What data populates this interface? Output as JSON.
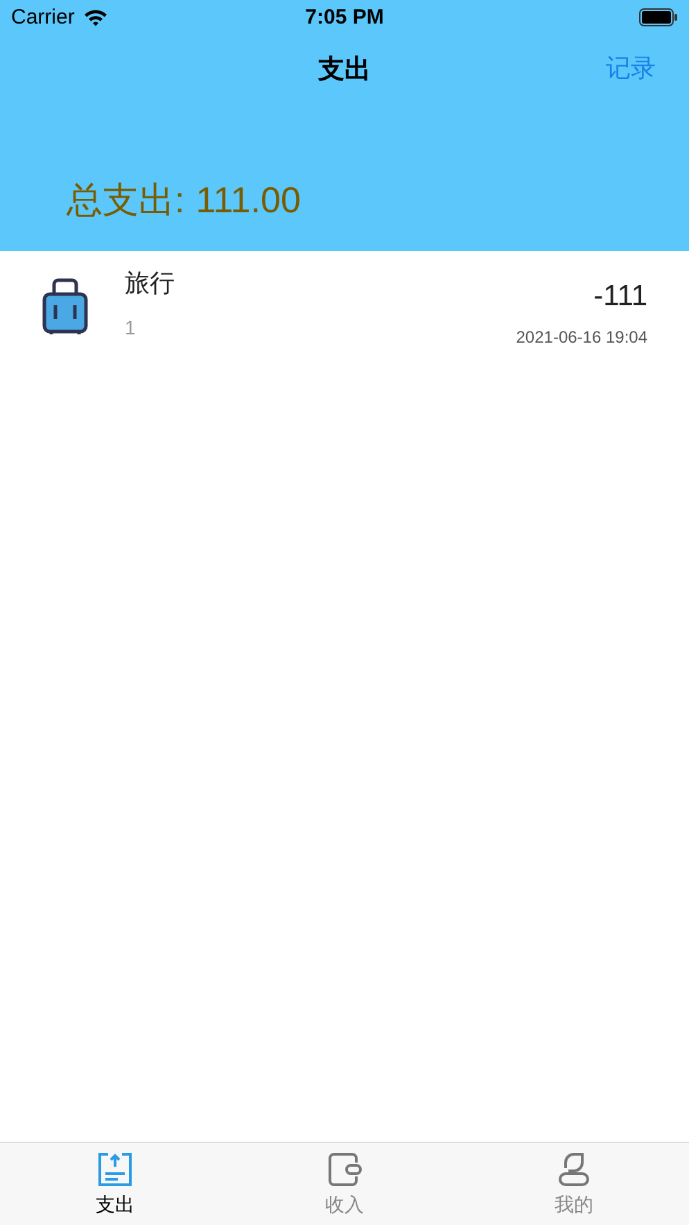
{
  "status_bar": {
    "carrier": "Carrier",
    "time": "7:05 PM"
  },
  "nav": {
    "title": "支出",
    "action": "记录"
  },
  "summary": {
    "label": "总支出:",
    "amount": "111.00"
  },
  "records": [
    {
      "category": "旅行",
      "note": "1",
      "amount": "-111",
      "date": "2021-06-16 19:04"
    }
  ],
  "tab_bar": [
    {
      "kind": "expense",
      "label": "支出",
      "selected": true
    },
    {
      "kind": "income",
      "label": "收入",
      "selected": false
    },
    {
      "kind": "profile",
      "label": "我的",
      "selected": false
    }
  ]
}
